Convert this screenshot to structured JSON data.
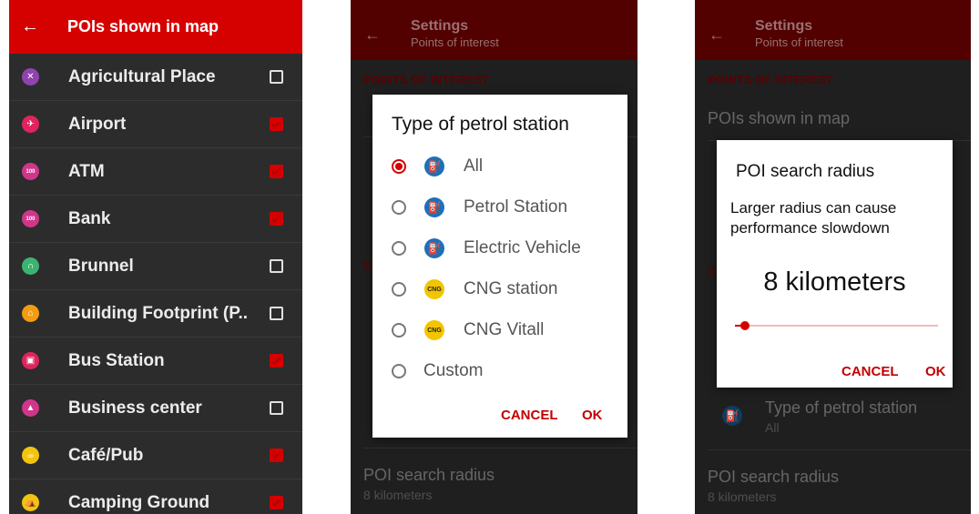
{
  "screen1": {
    "title": "POIs shown in map",
    "back_icon": "←",
    "items": [
      {
        "label": "Agricultural Place",
        "checked": false,
        "icon": "windmill-icon",
        "glyph": "✕",
        "color": "#8e44ad"
      },
      {
        "label": "Airport",
        "checked": true,
        "icon": "airplane-icon",
        "glyph": "✈",
        "color": "#e0245e"
      },
      {
        "label": "ATM",
        "checked": true,
        "icon": "atm-icon",
        "glyph": "100",
        "color": "#d0368a"
      },
      {
        "label": "Bank",
        "checked": true,
        "icon": "bank-icon",
        "glyph": "100",
        "color": "#d0368a"
      },
      {
        "label": "Brunnel",
        "checked": false,
        "icon": "tunnel-icon",
        "glyph": "∩",
        "color": "#3cb371"
      },
      {
        "label": "Building Footprint (P..",
        "checked": false,
        "icon": "building-icon",
        "glyph": "⌂",
        "color": "#f39c12"
      },
      {
        "label": "Bus Station",
        "checked": true,
        "icon": "bus-icon",
        "glyph": "▣",
        "color": "#e0245e"
      },
      {
        "label": "Business center",
        "checked": false,
        "icon": "business-icon",
        "glyph": "▲",
        "color": "#d0368a"
      },
      {
        "label": "Café/Pub",
        "checked": true,
        "icon": "cafe-icon",
        "glyph": "☕",
        "color": "#f1c40f"
      },
      {
        "label": "Camping Ground",
        "checked": true,
        "icon": "tent-icon",
        "glyph": "⛺",
        "color": "#f1c40f"
      }
    ]
  },
  "screen2": {
    "title": "Settings",
    "subtitle": "Points of interest",
    "section": "POINTS OF INTEREST",
    "partial_letter": "C",
    "bg_poi_radius": "POI search radius",
    "bg_poi_radius_value": "8 kilometers",
    "dialog": {
      "title": "Type of petrol station",
      "options": [
        {
          "label": "All",
          "selected": true,
          "icon": "fuel-icon",
          "kind": "fuel"
        },
        {
          "label": "Petrol Station",
          "selected": false,
          "icon": "fuel-icon",
          "kind": "fuel"
        },
        {
          "label": "Electric Vehicle",
          "selected": false,
          "icon": "ev-charger-icon",
          "kind": "fuel"
        },
        {
          "label": "CNG station",
          "selected": false,
          "icon": "cng-icon",
          "kind": "cng"
        },
        {
          "label": "CNG Vitall",
          "selected": false,
          "icon": "cng-icon",
          "kind": "cng"
        },
        {
          "label": "Custom",
          "selected": false,
          "icon": "",
          "kind": "none"
        }
      ],
      "cng_text": "CNG",
      "cancel": "CANCEL",
      "ok": "OK"
    }
  },
  "screen3": {
    "title": "Settings",
    "subtitle": "Points of interest",
    "section": "POINTS OF INTEREST",
    "partial_letter": "C",
    "bg_pois_shown": "POIs shown in map",
    "bg_petrol": "Type of petrol station",
    "bg_petrol_value": "All",
    "bg_poi_radius": "POI search radius",
    "bg_poi_radius_value": "8 kilometers",
    "dialog": {
      "title": "POI search radius",
      "message": "Larger radius can cause performance slowdown",
      "value": "8 kilometers",
      "slider_fraction": 0.05,
      "cancel": "CANCEL",
      "ok": "OK"
    }
  },
  "colors": {
    "accent": "#d50000",
    "dark_appbar": "#520000"
  }
}
